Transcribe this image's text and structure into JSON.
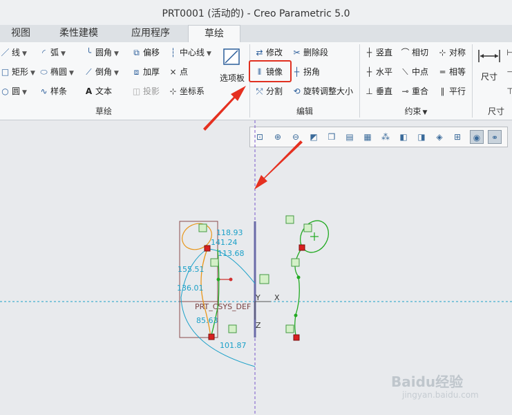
{
  "window": {
    "title": "PRT0001 (活动的) - Creo Parametric 5.0"
  },
  "tabs": [
    {
      "label": "视图",
      "active": false
    },
    {
      "label": "柔性建模",
      "active": false
    },
    {
      "label": "应用程序",
      "active": false
    },
    {
      "label": "草绘",
      "active": true
    }
  ],
  "ribbon": {
    "sketch_items": [
      {
        "label": "线",
        "icon": "line-icon",
        "dropdown": true
      },
      {
        "label": "弧",
        "icon": "arc-icon",
        "dropdown": true
      },
      {
        "label": "圆角",
        "icon": "fillet-icon",
        "dropdown": true
      },
      {
        "label": "偏移",
        "icon": "offset-icon",
        "dropdown": false
      },
      {
        "label": "中心线",
        "icon": "centerline-icon",
        "dropdown": true
      },
      {
        "label": "矩形",
        "icon": "rectangle-icon",
        "dropdown": true
      },
      {
        "label": "椭圆",
        "icon": "ellipse-icon",
        "dropdown": true
      },
      {
        "label": "倒角",
        "icon": "chamfer-icon",
        "dropdown": true
      },
      {
        "label": "加厚",
        "icon": "thicken-icon",
        "dropdown": false
      },
      {
        "label": "点",
        "icon": "point-icon",
        "dropdown": false
      },
      {
        "label": "圆",
        "icon": "circle-icon",
        "dropdown": true
      },
      {
        "label": "样条",
        "icon": "spline-icon",
        "dropdown": false
      },
      {
        "label": "文本",
        "icon": "text-icon",
        "dropdown": false
      },
      {
        "label": "投影",
        "icon": "project-icon",
        "dropdown": false
      },
      {
        "label": "坐标系",
        "icon": "coord-system-icon",
        "dropdown": false
      }
    ],
    "palette_label": "选项板",
    "sketch_group_label": "草绘",
    "edit_items": [
      {
        "label": "修改",
        "icon": "modify-icon"
      },
      {
        "label": "删除段",
        "icon": "delete-segment-icon"
      },
      {
        "label": "镜像",
        "icon": "mirror-icon"
      },
      {
        "label": "拐角",
        "icon": "corner-icon"
      },
      {
        "label": "分割",
        "icon": "divide-icon"
      },
      {
        "label": "旋转调整大小",
        "icon": "rotate-resize-icon"
      }
    ],
    "edit_group_label": "编辑",
    "constraint_items": [
      {
        "label": "竖直",
        "icon": "vertical-icon"
      },
      {
        "label": "相切",
        "icon": "tangent-icon"
      },
      {
        "label": "对称",
        "icon": "symmetric-icon"
      },
      {
        "label": "水平",
        "icon": "horizontal-icon"
      },
      {
        "label": "中点",
        "icon": "midpoint-icon"
      },
      {
        "label": "相等",
        "icon": "equal-icon"
      },
      {
        "label": "垂直",
        "icon": "perpendicular-icon"
      },
      {
        "label": "重合",
        "icon": "coincident-icon"
      },
      {
        "label": "平行",
        "icon": "parallel-icon"
      }
    ],
    "constraint_group_label": "约束",
    "dimension_label": "尺寸",
    "dimension_group_label": "尺寸"
  },
  "view_toolbar": [
    "zoom-fit-icon",
    "zoom-in-icon",
    "zoom-out-icon",
    "repaint-icon",
    "display-style-icon",
    "saved-views-icon",
    "view-manager-icon",
    "perspective-icon",
    "datum-display-icon",
    "annotation-display-icon",
    "spin-center-icon",
    "sketch-view-icon",
    "sketcher-display-icon",
    "constraint-display-icon"
  ],
  "dimensions": [
    "118.93",
    "141.24",
    "113.68",
    "155.51",
    "136.01",
    "85.63",
    "101.87"
  ],
  "canvas_labels": {
    "csys": "PRT_CSYS_DEF",
    "axis_y": "Y",
    "axis_x": "X",
    "axis_z": "Z"
  },
  "watermark": {
    "brand": "Baidu经验",
    "url": "jingyan.baidu.com"
  },
  "colors": {
    "highlight": "#e03020",
    "dimension": "#1aa0c8",
    "sketch_green": "#22aa22",
    "sketch_orange": "#e8961a"
  }
}
